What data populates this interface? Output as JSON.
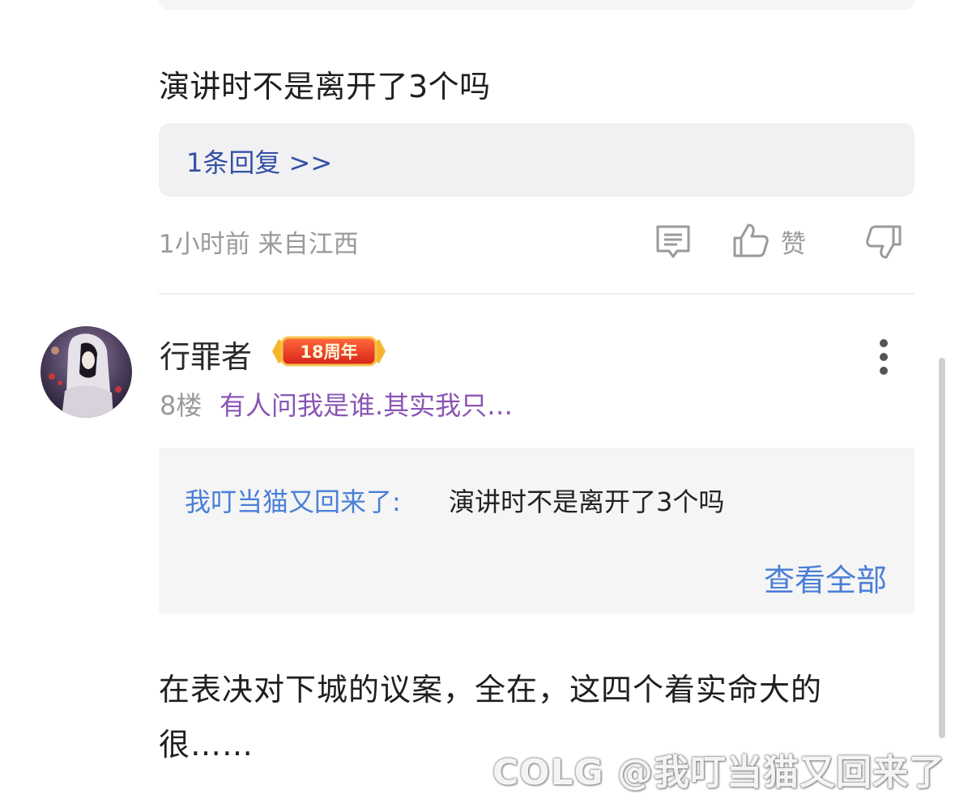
{
  "prev_comment": {
    "text": "演讲时不是离开了3个吗",
    "reply_link": "1条回复 >>",
    "meta": "1小时前 来自江西",
    "like_label": "赞"
  },
  "comment": {
    "username": "行罪者",
    "badge": "18周年",
    "floor": "8楼",
    "signature": "有人问我是谁.其实我只…",
    "quoted_reply": {
      "user": "我叮当猫又回来了:",
      "text": "演讲时不是离开了3个吗",
      "view_all": "查看全部"
    },
    "body_line1": "在表决对下城的议案，全在，这四个着实命大的",
    "body_line2": "很……"
  },
  "watermark": "COLG @我叮当猫又回来了",
  "colors": {
    "link_blue": "#4a7fd8",
    "reply_blue": "#3450a6",
    "signature_purple": "#8a55b4",
    "meta_gray": "#9a9a9a"
  }
}
